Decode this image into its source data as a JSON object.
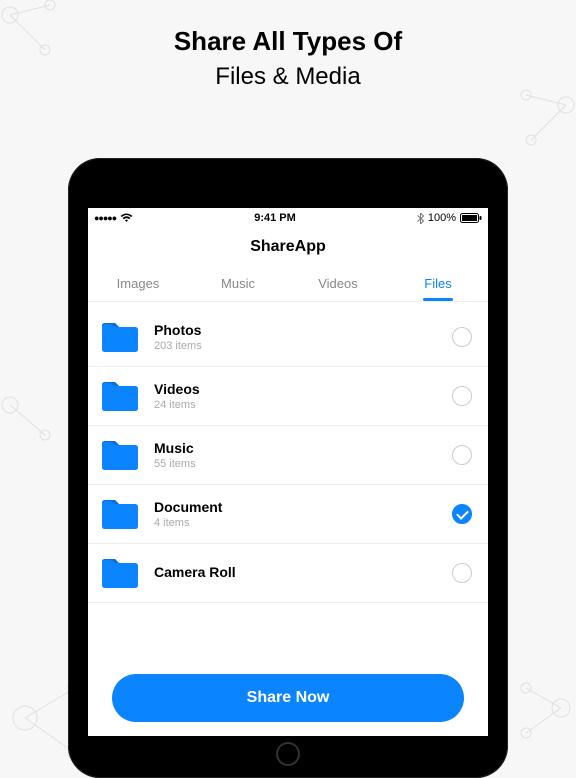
{
  "headline": {
    "line1": "Share All Types Of",
    "line2": "Files & Media"
  },
  "status": {
    "time": "9:41 PM",
    "battery": "100%"
  },
  "app": {
    "title": "ShareApp"
  },
  "tabs": [
    {
      "label": "Images",
      "active": false
    },
    {
      "label": "Music",
      "active": false
    },
    {
      "label": "Videos",
      "active": false
    },
    {
      "label": "Files",
      "active": true
    }
  ],
  "folders": [
    {
      "name": "Photos",
      "count": "203 items",
      "selected": false
    },
    {
      "name": "Videos",
      "count": "24 items",
      "selected": false
    },
    {
      "name": "Music",
      "count": "55 items",
      "selected": false
    },
    {
      "name": "Document",
      "count": "4 items",
      "selected": true
    },
    {
      "name": "Camera Roll",
      "count": "",
      "selected": false
    }
  ],
  "cta": {
    "label": "Share Now"
  },
  "colors": {
    "accent": "#0a84ff"
  }
}
